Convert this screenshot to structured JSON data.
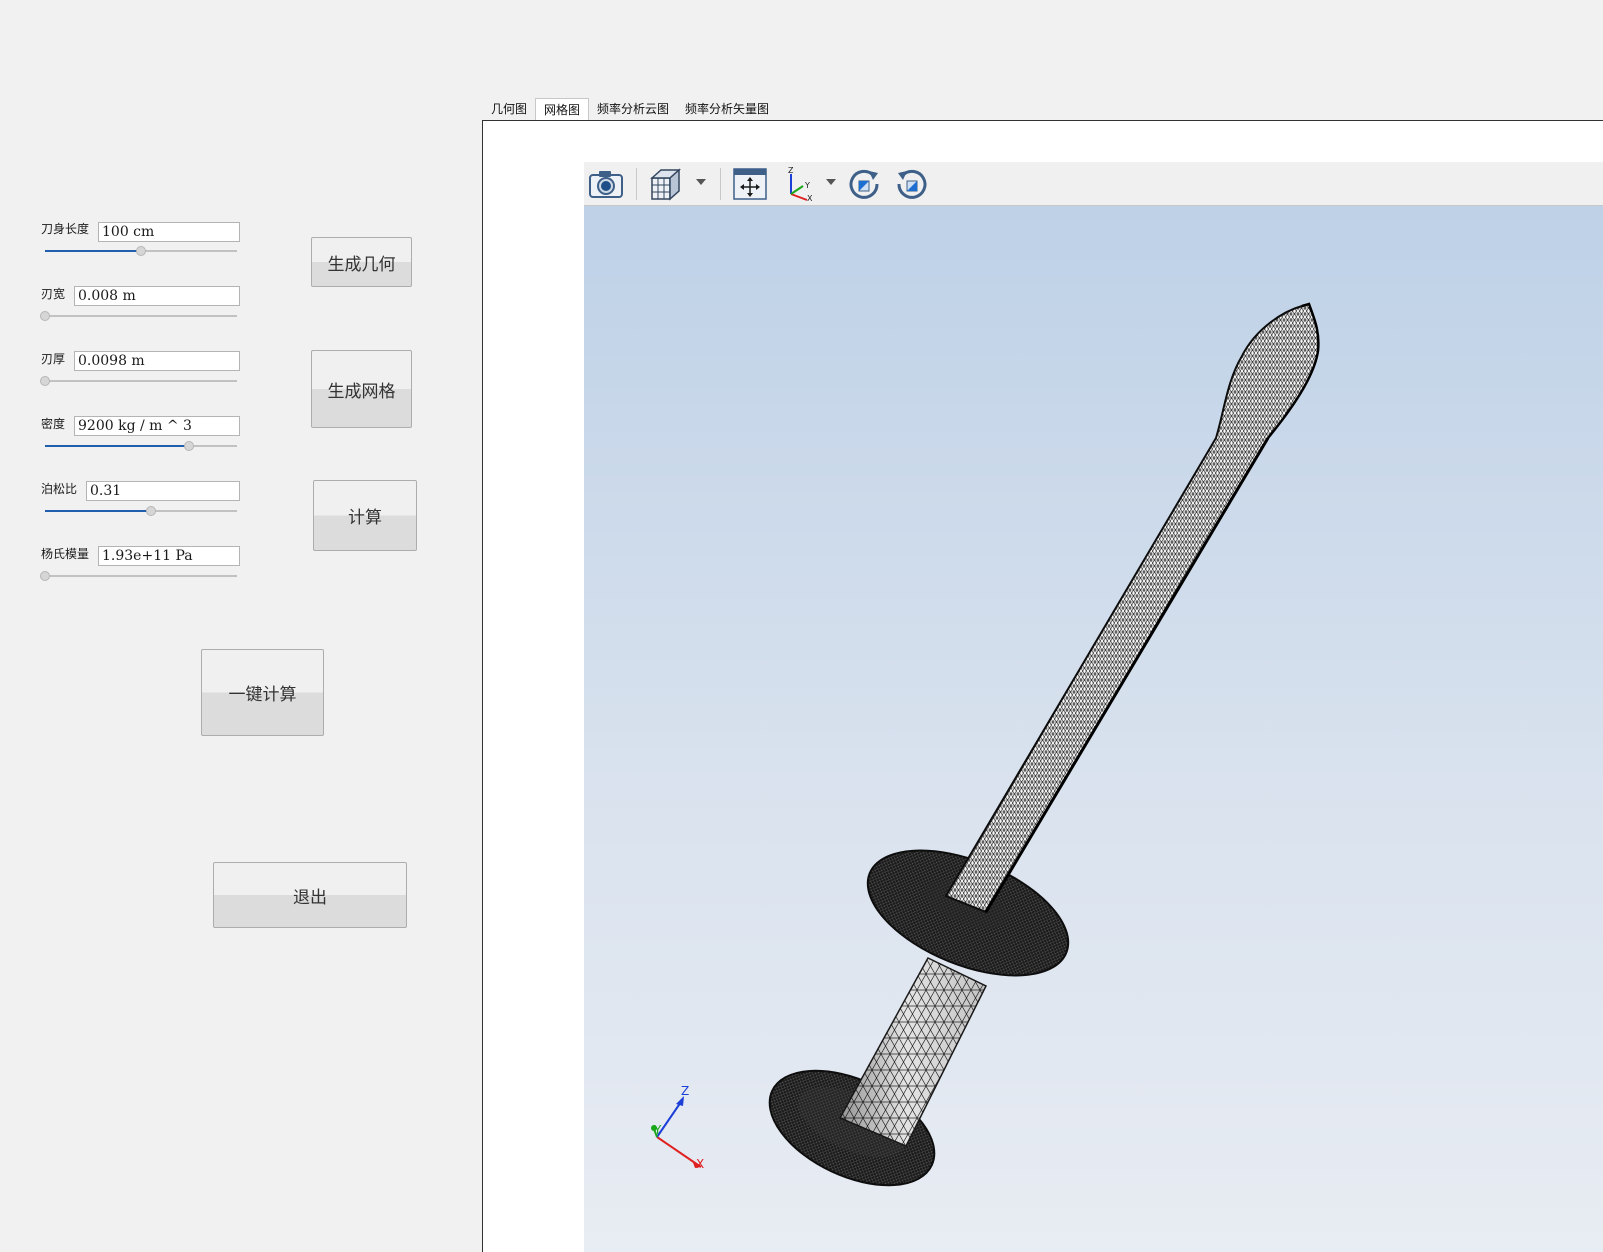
{
  "params": [
    {
      "label": "刀身长度",
      "value": "100 cm",
      "slider": 0.5
    },
    {
      "label": "刃宽",
      "value": "0.008 m",
      "slider": 0.0
    },
    {
      "label": "刃厚",
      "value": "0.0098 m",
      "slider": 0.0
    },
    {
      "label": "密度",
      "value": "9200 kg / m ^ 3",
      "slider": 0.75
    },
    {
      "label": "泊松比",
      "value": "0.31",
      "slider": 0.55
    },
    {
      "label": "杨氏模量",
      "value": "1.93e+11 Pa",
      "slider": 0.0
    }
  ],
  "buttons": {
    "gen_geometry": "生成几何",
    "gen_mesh": "生成网格",
    "compute": "计算",
    "one_click": "一键计算",
    "exit": "退出"
  },
  "tabs": [
    "几何图",
    "网格图",
    "频率分析云图",
    "频率分析矢量图"
  ],
  "active_tab": "网格图",
  "toolbar": {
    "icons": [
      "camera-icon",
      "view-cube-icon",
      "fit-all-icon",
      "axes-icon",
      "rotate-cw-icon",
      "rotate-ccw-icon"
    ]
  },
  "viewport": {
    "background_top": "#bed1e7",
    "background_bottom": "#e8ecf3",
    "triad": {
      "x": "X",
      "y": "Y",
      "z": "Z"
    }
  },
  "colors": {
    "slider_fill": "#1f5fae",
    "axis_x": "#e02020",
    "axis_y": "#1aa81a",
    "axis_z": "#1c3fd8"
  }
}
